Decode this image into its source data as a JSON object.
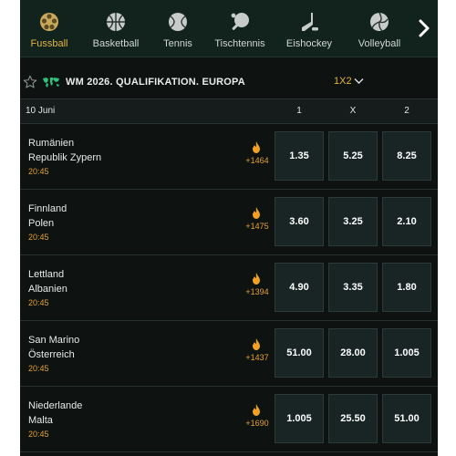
{
  "sports": [
    {
      "label": "Fussball",
      "icon": "football-icon",
      "active": true
    },
    {
      "label": "Basketball",
      "icon": "basketball-icon",
      "active": false
    },
    {
      "label": "Tennis",
      "icon": "tennis-icon",
      "active": false
    },
    {
      "label": "Tischtennis",
      "icon": "table-tennis-icon",
      "active": false
    },
    {
      "label": "Eishockey",
      "icon": "ice-hockey-icon",
      "active": false
    },
    {
      "label": "Volleyball",
      "icon": "volleyball-icon",
      "active": false
    }
  ],
  "competition": {
    "title": "WM 2026. QUALIFIKATION. EUROPA",
    "market": "1X2"
  },
  "table": {
    "date": "10 Juni",
    "columns": [
      "1",
      "X",
      "2"
    ]
  },
  "matches": [
    {
      "home": "Rumänien",
      "away": "Republik Zypern",
      "time": "20:45",
      "count": "+1464",
      "odds": [
        "1.35",
        "5.25",
        "8.25"
      ]
    },
    {
      "home": "Finnland",
      "away": "Polen",
      "time": "20:45",
      "count": "+1475",
      "odds": [
        "3.60",
        "3.25",
        "2.10"
      ]
    },
    {
      "home": "Lettland",
      "away": "Albanien",
      "time": "20:45",
      "count": "+1394",
      "odds": [
        "4.90",
        "3.35",
        "1.80"
      ]
    },
    {
      "home": "San Marino",
      "away": "Österreich",
      "time": "20:45",
      "count": "+1437",
      "odds": [
        "51.00",
        "28.00",
        "1.005"
      ]
    },
    {
      "home": "Niederlande",
      "away": "Malta",
      "time": "20:45",
      "count": "+1690",
      "odds": [
        "1.005",
        "25.50",
        "51.00"
      ]
    }
  ],
  "colors": {
    "accent": "#e3b440",
    "nav_background": "#12231e",
    "page_background": "#0e1211",
    "odds_box": "#192524"
  }
}
